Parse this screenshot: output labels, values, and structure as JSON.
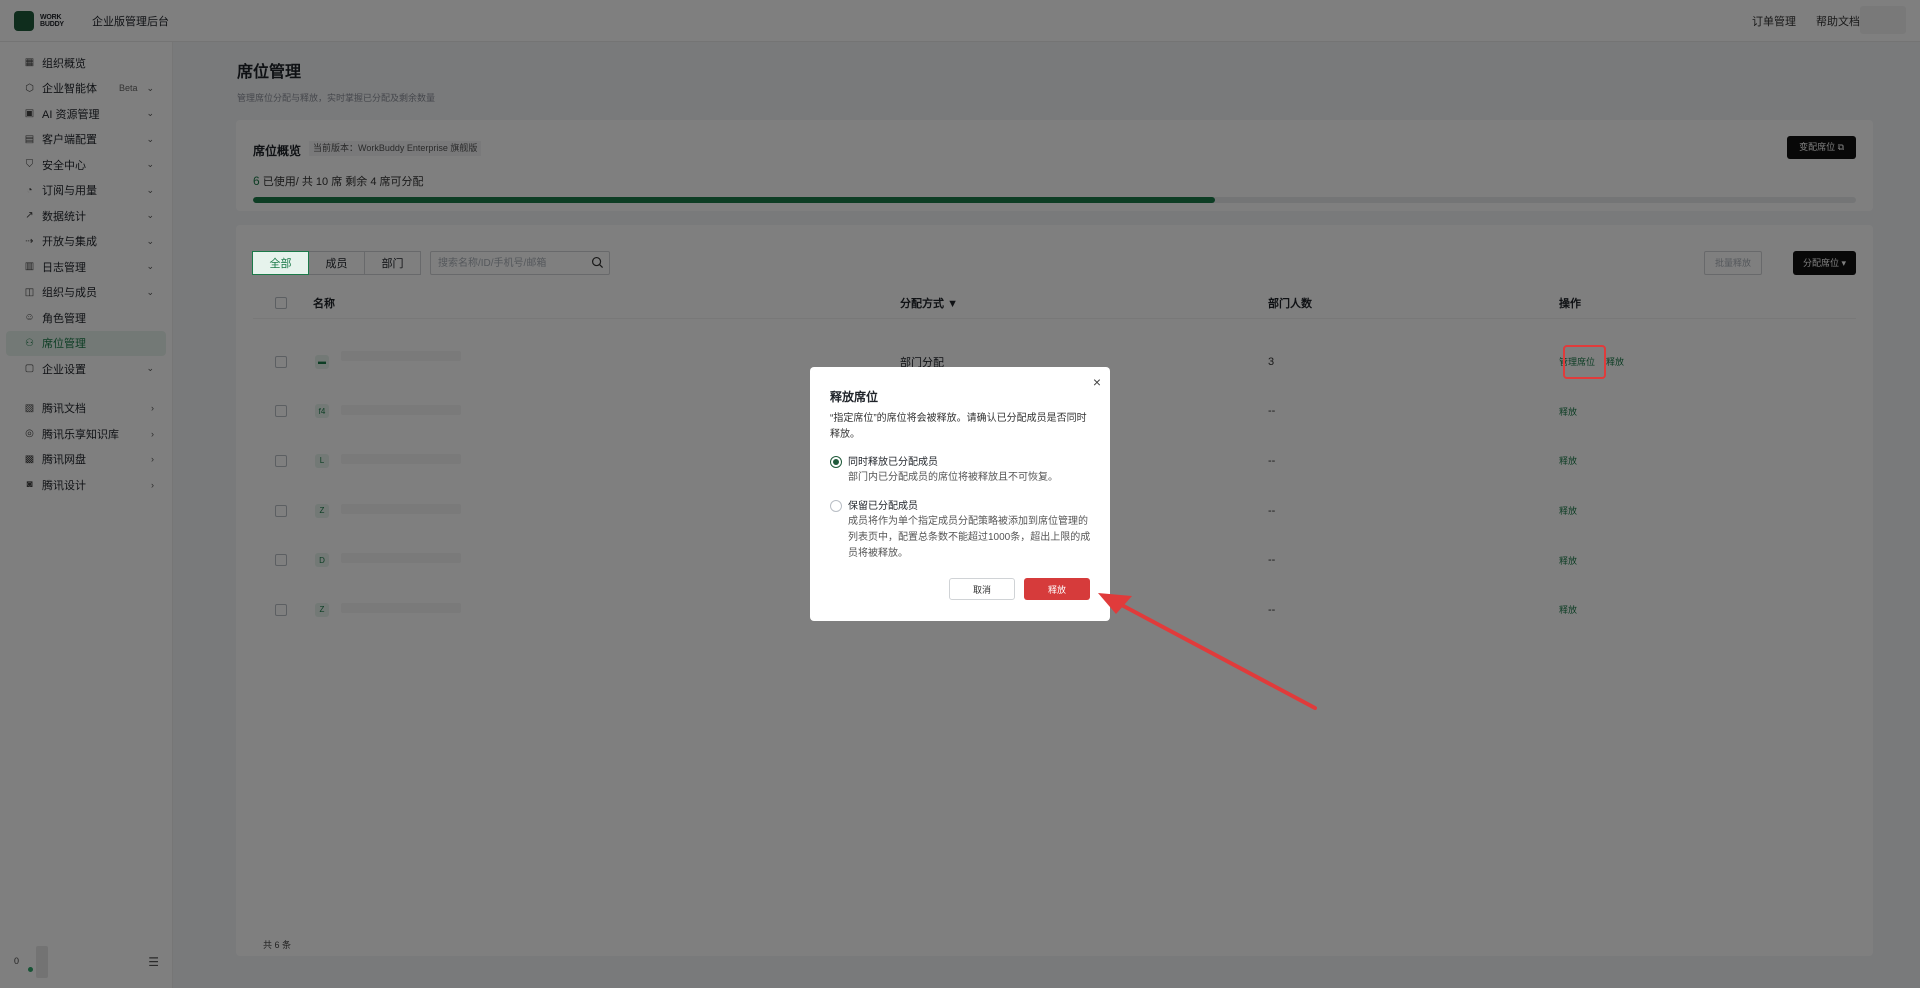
{
  "header": {
    "logo_text": "WORK BUDDY",
    "title": "企业版管理后台",
    "links": [
      "订单管理",
      "帮助文档"
    ]
  },
  "sidebar": {
    "items": [
      {
        "label": "组织概览",
        "icon": "grid-icon",
        "chevron": false
      },
      {
        "label": "企业智能体",
        "icon": "agent-icon",
        "badge": "Beta",
        "chevron": true
      },
      {
        "label": "AI 资源管理",
        "icon": "ai-icon",
        "chevron": true
      },
      {
        "label": "客户端配置",
        "icon": "client-icon",
        "chevron": true
      },
      {
        "label": "安全中心",
        "icon": "shield-icon",
        "chevron": true
      },
      {
        "label": "订阅与用量",
        "icon": "clock-icon",
        "chevron": true
      },
      {
        "label": "数据统计",
        "icon": "chart-icon",
        "chevron": true
      },
      {
        "label": "开放与集成",
        "icon": "integration-icon",
        "chevron": true
      },
      {
        "label": "日志管理",
        "icon": "log-icon",
        "chevron": true
      },
      {
        "label": "组织与成员",
        "icon": "org-icon",
        "chevron": true
      },
      {
        "label": "角色管理",
        "icon": "role-icon",
        "chevron": false
      },
      {
        "label": "席位管理",
        "icon": "seat-icon",
        "chevron": false,
        "active": true
      },
      {
        "label": "企业设置",
        "icon": "settings-icon",
        "chevron": true
      }
    ],
    "external": [
      {
        "label": "腾讯文档",
        "icon": "doc-icon"
      },
      {
        "label": "腾讯乐享知识库",
        "icon": "knowledge-icon"
      },
      {
        "label": "腾讯网盘",
        "icon": "disk-icon"
      },
      {
        "label": "腾讯设计",
        "icon": "design-icon"
      }
    ],
    "footer_user": "0"
  },
  "page": {
    "title": "席位管理",
    "subtitle": "管理席位分配与释放，实时掌握已分配及剩余数量"
  },
  "overview": {
    "title": "席位概览",
    "version_label": "当前版本：WorkBuddy Enterprise 旗舰版",
    "change_button": "变配席位 ⧉",
    "used": "6",
    "stats_text": "已使用/ 共 10 席   剩余 4 席可分配",
    "progress": 0.6
  },
  "table": {
    "tabs": [
      "全部",
      "成员",
      "部门"
    ],
    "active_tab": "全部",
    "search_placeholder": "搜索名称/ID/手机号/邮箱",
    "batch_button": "批量释放",
    "assign_button": "分配席位 ▾",
    "columns": [
      "名称",
      "分配方式",
      "部门人数",
      "操作"
    ],
    "rows": [
      {
        "avatar": "▬",
        "method": "部门分配",
        "count": "3",
        "ops": [
          "管理席位",
          "释放"
        ]
      },
      {
        "avatar": "f4",
        "method": "",
        "count": "--",
        "ops": [
          "释放"
        ]
      },
      {
        "avatar": "L",
        "method": "",
        "count": "--",
        "ops": [
          "释放"
        ]
      },
      {
        "avatar": "Z",
        "method": "",
        "count": "--",
        "ops": [
          "释放"
        ]
      },
      {
        "avatar": "D",
        "method": "",
        "count": "--",
        "ops": [
          "释放"
        ]
      },
      {
        "avatar": "Z",
        "method": "",
        "count": "--",
        "ops": [
          "释放"
        ]
      }
    ],
    "total": "共 6 条"
  },
  "modal": {
    "title": "释放席位",
    "description": "“指定席位”的席位将会被释放。请确认已分配成员是否同时释放。",
    "options": [
      {
        "title": "同时释放已分配成员",
        "desc": "部门内已分配成员的席位将被释放且不可恢复。",
        "selected": true
      },
      {
        "title": "保留已分配成员",
        "desc": "成员将作为单个指定成员分配策略被添加到席位管理的列表页中，配置总条数不能超过1000条，超出上限的成员将被释放。",
        "selected": false
      }
    ],
    "cancel": "取消",
    "confirm": "释放"
  },
  "colors": {
    "accent": "#1b7a49",
    "danger": "#d63b3b",
    "annotation": "#e03b3b"
  }
}
